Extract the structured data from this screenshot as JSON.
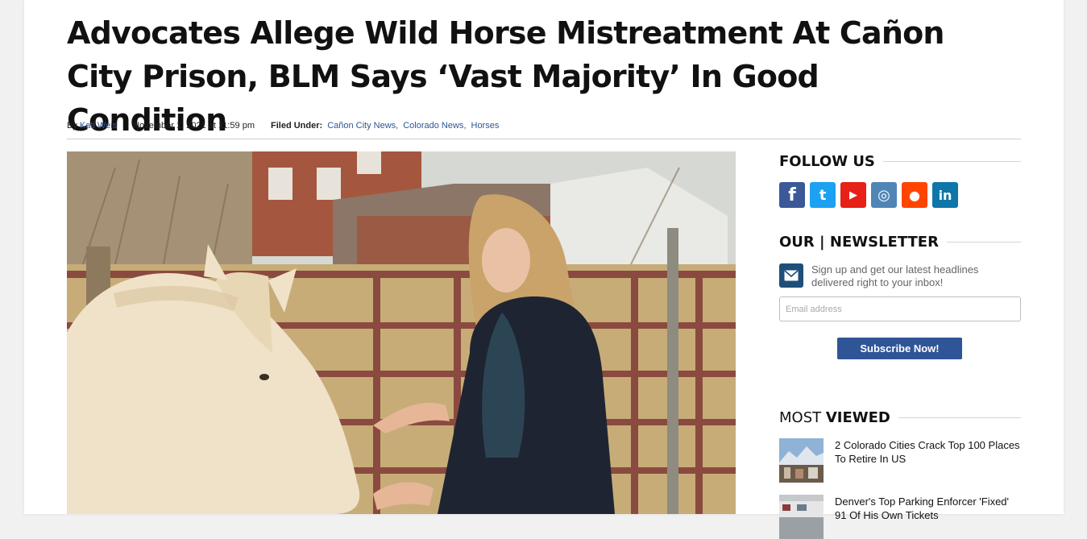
{
  "article": {
    "headline": "Advocates Allege Wild Horse Mistreatment At Cañon City Prison, BLM Says ‘Vast Majority’ In Good Condition",
    "by_prefix": "By",
    "author": "Kati Weis",
    "date": "November 1, 2021 at 11:59 pm",
    "filed_label": "Filed Under:",
    "categories": [
      "Cañon City News",
      "Colorado News",
      "Horses"
    ],
    "category_separator": ","
  },
  "sidebar": {
    "follow": {
      "title": "FOLLOW US"
    },
    "social": [
      {
        "name": "facebook",
        "glyph": "f",
        "color": "#3b5998"
      },
      {
        "name": "twitter",
        "glyph": "t",
        "color": "#1da1f2"
      },
      {
        "name": "youtube",
        "glyph": "▶",
        "color": "#e62117"
      },
      {
        "name": "instagram",
        "glyph": "◎",
        "color": "#4f86b7"
      },
      {
        "name": "reddit",
        "glyph": "●",
        "color": "#ff4500"
      },
      {
        "name": "linkedin",
        "glyph": "in",
        "color": "#0e76a8"
      }
    ],
    "newsletter": {
      "title": "OUR | NEWSLETTER",
      "text": "Sign up and get our latest headlines delivered right to your inbox!",
      "email_placeholder": "Email address",
      "email_value": "",
      "button": "Subscribe Now!"
    },
    "most_viewed": {
      "title_light": "MOST",
      "title_bold": "VIEWED",
      "items": [
        {
          "title": "2 Colorado Cities Crack Top 100 Places To Retire In US"
        },
        {
          "title": "Denver's Top Parking Enforcer 'Fixed' 91 Of His Own Tickets"
        }
      ]
    }
  }
}
